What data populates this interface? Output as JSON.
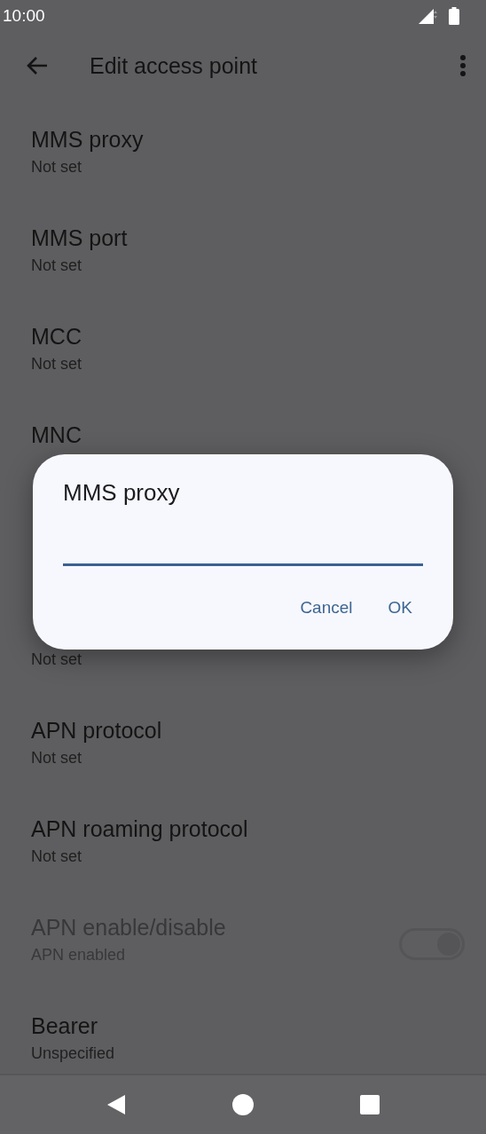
{
  "status_bar": {
    "time": "10:00"
  },
  "app_bar": {
    "title": "Edit access point"
  },
  "settings": [
    {
      "kind": "text",
      "title": "MMS proxy",
      "summary": "Not set"
    },
    {
      "kind": "text",
      "title": "MMS port",
      "summary": "Not set"
    },
    {
      "kind": "text",
      "title": "MCC",
      "summary": "Not set"
    },
    {
      "kind": "text",
      "title": "MNC"
    },
    {
      "kind": "hidden"
    },
    {
      "kind": "text",
      "summary": "Not set"
    },
    {
      "kind": "text",
      "title": "APN protocol",
      "summary": "Not set"
    },
    {
      "kind": "text",
      "title": "APN roaming protocol",
      "summary": "Not set"
    },
    {
      "kind": "switch",
      "title": "APN enable/disable",
      "summary": "APN enabled",
      "disabled": true,
      "on": true
    },
    {
      "kind": "text",
      "title": "Bearer",
      "summary": "Unspecified"
    }
  ],
  "dialog": {
    "title": "MMS proxy",
    "buttons": [
      "Cancel",
      "OK"
    ]
  }
}
